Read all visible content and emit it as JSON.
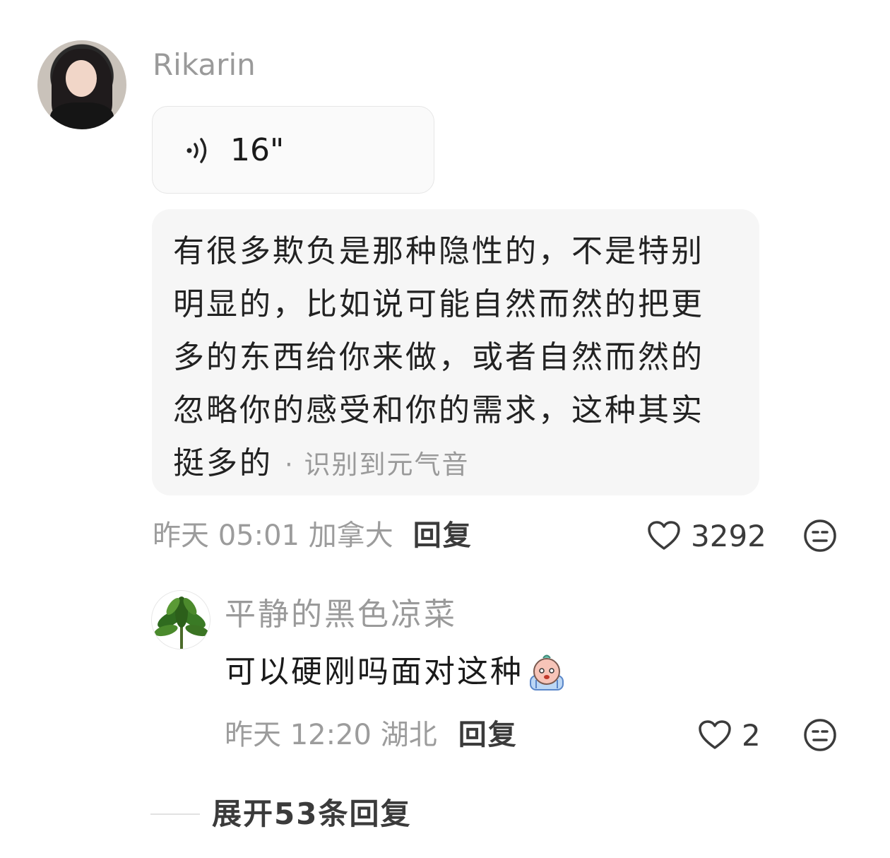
{
  "comment": {
    "username": "Rikarin",
    "voice_duration": "16\"",
    "transcript_lines": [
      "有很多欺负是那种隐性的，不是特别",
      "明显的，比如说可能自然而然的把更",
      "多的东西给你来做，或者自然而然的",
      "忽略你的感受和你的需求，这种其实",
      "挺多的"
    ],
    "transcript_tag": "· 识别到元气音",
    "time": "昨天 05:01 加拿大",
    "reply_label": "回复",
    "like_count": "3292"
  },
  "reply": {
    "username": "平静的黑色凉菜",
    "text": "可以硬刚吗面对这种",
    "time": "昨天 12:20 湖北",
    "reply_label": "回复",
    "like_count": "2"
  },
  "expand_label": "展开53条回复",
  "colors": {
    "muted_text": "#9a9a9a",
    "body_text": "#1a1a1a",
    "bubble_bg": "#f6f6f6"
  },
  "icons": {
    "voice": "voice-wave-icon",
    "like": "heart-icon",
    "emoji": "neutral-face-icon",
    "sticker": "crying-sticker-icon"
  }
}
